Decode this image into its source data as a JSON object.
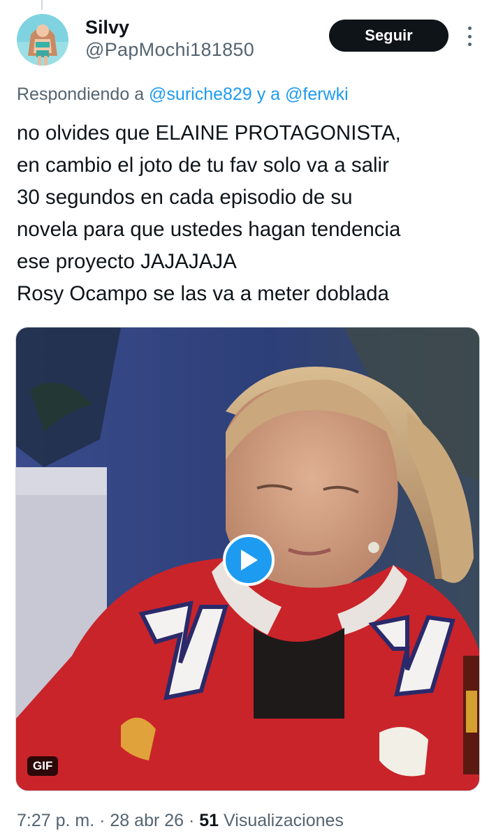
{
  "tweet": {
    "display_name": "Silvy",
    "handle": "@PapMochi181850",
    "follow_label": "Seguir",
    "reply_prefix": "Respondiendo a",
    "reply_mention_1": "@suriche829",
    "reply_joiner": "y a",
    "reply_mention_2": "@ferwki",
    "text_lines": [
      "no olvides que ELAINE PROTAGONISTA,",
      "en cambio el joto de tu fav solo va a salir",
      "30 segundos en cada episodio de su",
      "novela para que ustedes hagan tendencia",
      "ese proyecto JAJAJAJA",
      "Rosy Ocampo se las va a meter doblada"
    ],
    "media_badge": "GIF",
    "time": "7:27 p. m.",
    "separator": "·",
    "date": "28 abr 26",
    "views_count": "51",
    "views_label": "Visualizaciones"
  },
  "icons": {
    "more": "more-vertical-icon",
    "play": "play-icon"
  },
  "colors": {
    "accent": "#1d9bf0",
    "text_primary": "#0f1419",
    "text_secondary": "#536471",
    "button_bg": "#0f1419"
  }
}
